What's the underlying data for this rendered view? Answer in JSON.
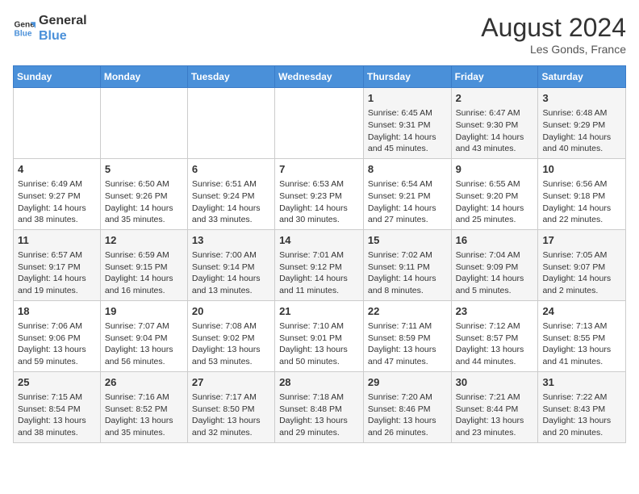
{
  "header": {
    "logo_line1": "General",
    "logo_line2": "Blue",
    "month": "August 2024",
    "location": "Les Gonds, France"
  },
  "days_of_week": [
    "Sunday",
    "Monday",
    "Tuesday",
    "Wednesday",
    "Thursday",
    "Friday",
    "Saturday"
  ],
  "weeks": [
    [
      {
        "day": "",
        "info": ""
      },
      {
        "day": "",
        "info": ""
      },
      {
        "day": "",
        "info": ""
      },
      {
        "day": "",
        "info": ""
      },
      {
        "day": "1",
        "info": "Sunrise: 6:45 AM\nSunset: 9:31 PM\nDaylight: 14 hours\nand 45 minutes."
      },
      {
        "day": "2",
        "info": "Sunrise: 6:47 AM\nSunset: 9:30 PM\nDaylight: 14 hours\nand 43 minutes."
      },
      {
        "day": "3",
        "info": "Sunrise: 6:48 AM\nSunset: 9:29 PM\nDaylight: 14 hours\nand 40 minutes."
      }
    ],
    [
      {
        "day": "4",
        "info": "Sunrise: 6:49 AM\nSunset: 9:27 PM\nDaylight: 14 hours\nand 38 minutes."
      },
      {
        "day": "5",
        "info": "Sunrise: 6:50 AM\nSunset: 9:26 PM\nDaylight: 14 hours\nand 35 minutes."
      },
      {
        "day": "6",
        "info": "Sunrise: 6:51 AM\nSunset: 9:24 PM\nDaylight: 14 hours\nand 33 minutes."
      },
      {
        "day": "7",
        "info": "Sunrise: 6:53 AM\nSunset: 9:23 PM\nDaylight: 14 hours\nand 30 minutes."
      },
      {
        "day": "8",
        "info": "Sunrise: 6:54 AM\nSunset: 9:21 PM\nDaylight: 14 hours\nand 27 minutes."
      },
      {
        "day": "9",
        "info": "Sunrise: 6:55 AM\nSunset: 9:20 PM\nDaylight: 14 hours\nand 25 minutes."
      },
      {
        "day": "10",
        "info": "Sunrise: 6:56 AM\nSunset: 9:18 PM\nDaylight: 14 hours\nand 22 minutes."
      }
    ],
    [
      {
        "day": "11",
        "info": "Sunrise: 6:57 AM\nSunset: 9:17 PM\nDaylight: 14 hours\nand 19 minutes."
      },
      {
        "day": "12",
        "info": "Sunrise: 6:59 AM\nSunset: 9:15 PM\nDaylight: 14 hours\nand 16 minutes."
      },
      {
        "day": "13",
        "info": "Sunrise: 7:00 AM\nSunset: 9:14 PM\nDaylight: 14 hours\nand 13 minutes."
      },
      {
        "day": "14",
        "info": "Sunrise: 7:01 AM\nSunset: 9:12 PM\nDaylight: 14 hours\nand 11 minutes."
      },
      {
        "day": "15",
        "info": "Sunrise: 7:02 AM\nSunset: 9:11 PM\nDaylight: 14 hours\nand 8 minutes."
      },
      {
        "day": "16",
        "info": "Sunrise: 7:04 AM\nSunset: 9:09 PM\nDaylight: 14 hours\nand 5 minutes."
      },
      {
        "day": "17",
        "info": "Sunrise: 7:05 AM\nSunset: 9:07 PM\nDaylight: 14 hours\nand 2 minutes."
      }
    ],
    [
      {
        "day": "18",
        "info": "Sunrise: 7:06 AM\nSunset: 9:06 PM\nDaylight: 13 hours\nand 59 minutes."
      },
      {
        "day": "19",
        "info": "Sunrise: 7:07 AM\nSunset: 9:04 PM\nDaylight: 13 hours\nand 56 minutes."
      },
      {
        "day": "20",
        "info": "Sunrise: 7:08 AM\nSunset: 9:02 PM\nDaylight: 13 hours\nand 53 minutes."
      },
      {
        "day": "21",
        "info": "Sunrise: 7:10 AM\nSunset: 9:01 PM\nDaylight: 13 hours\nand 50 minutes."
      },
      {
        "day": "22",
        "info": "Sunrise: 7:11 AM\nSunset: 8:59 PM\nDaylight: 13 hours\nand 47 minutes."
      },
      {
        "day": "23",
        "info": "Sunrise: 7:12 AM\nSunset: 8:57 PM\nDaylight: 13 hours\nand 44 minutes."
      },
      {
        "day": "24",
        "info": "Sunrise: 7:13 AM\nSunset: 8:55 PM\nDaylight: 13 hours\nand 41 minutes."
      }
    ],
    [
      {
        "day": "25",
        "info": "Sunrise: 7:15 AM\nSunset: 8:54 PM\nDaylight: 13 hours\nand 38 minutes."
      },
      {
        "day": "26",
        "info": "Sunrise: 7:16 AM\nSunset: 8:52 PM\nDaylight: 13 hours\nand 35 minutes."
      },
      {
        "day": "27",
        "info": "Sunrise: 7:17 AM\nSunset: 8:50 PM\nDaylight: 13 hours\nand 32 minutes."
      },
      {
        "day": "28",
        "info": "Sunrise: 7:18 AM\nSunset: 8:48 PM\nDaylight: 13 hours\nand 29 minutes."
      },
      {
        "day": "29",
        "info": "Sunrise: 7:20 AM\nSunset: 8:46 PM\nDaylight: 13 hours\nand 26 minutes."
      },
      {
        "day": "30",
        "info": "Sunrise: 7:21 AM\nSunset: 8:44 PM\nDaylight: 13 hours\nand 23 minutes."
      },
      {
        "day": "31",
        "info": "Sunrise: 7:22 AM\nSunset: 8:43 PM\nDaylight: 13 hours\nand 20 minutes."
      }
    ]
  ]
}
